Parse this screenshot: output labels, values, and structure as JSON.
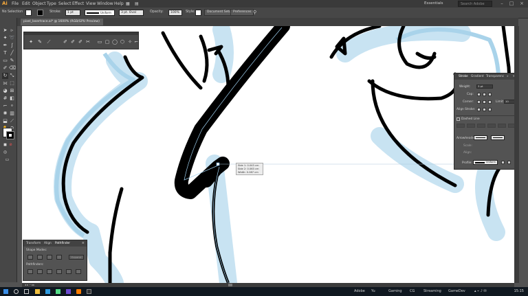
{
  "app": {
    "logo": "Ai"
  },
  "menubar": {
    "items": [
      "File",
      "Edit",
      "Object",
      "Type",
      "Select",
      "Effect",
      "View",
      "Window",
      "Help"
    ],
    "workspace": "Essentials",
    "search_placeholder": "Search Adobe Stock"
  },
  "controlbar": {
    "selection": "No Selection",
    "stroke_label": "Stroke:",
    "stroke_value": "1 pt",
    "profile_value": "Uniform",
    "brush_value": "3 pt. Oval",
    "opacity_label": "Opacity:",
    "opacity_value": "100%",
    "style_label": "Style:",
    "doc_setup": "Document Setup",
    "preferences": "Preferences"
  },
  "document": {
    "tab": "pixel_lasertrace.ai* @ 1600% (RGB/GPU Preview)"
  },
  "stroke_panel": {
    "tabs": [
      "Stroke",
      "Gradient",
      "Transparenc"
    ],
    "weight_label": "Weight:",
    "weight_value": "3 pt",
    "cap_label": "Cap:",
    "corner_label": "Corner:",
    "limit_label": "Limit:",
    "limit_value": "10",
    "align_label": "Align Stroke:",
    "dashed_label": "Dashed Line",
    "arrowheads_label": "Arrowheads:",
    "scale_label": "Scale:",
    "align2_label": "Align:",
    "profile_label": "Profile:",
    "profile_value": "Uniform"
  },
  "pathfinder_panel": {
    "tabs": [
      "Transform",
      "Align",
      "Pathfinder"
    ],
    "shape_modes_label": "Shape Modes:",
    "pathfinders_label": "Pathfinders:",
    "expand_label": "Expand"
  },
  "measure": {
    "side1": "Side 1: 0.043 cm",
    "side2": "Side 2: 0.063 cm",
    "width": "Width: 0.087 cm"
  },
  "taskbar": {
    "items": [
      "Adobe",
      "Yu",
      "Gaming",
      "CG",
      "Streaming",
      "GameDev"
    ],
    "clock": "15:15"
  },
  "colors": {
    "accent": "#f7a93b",
    "ui_bg": "#535353",
    "artwork_glow": "#bfe0f0"
  }
}
